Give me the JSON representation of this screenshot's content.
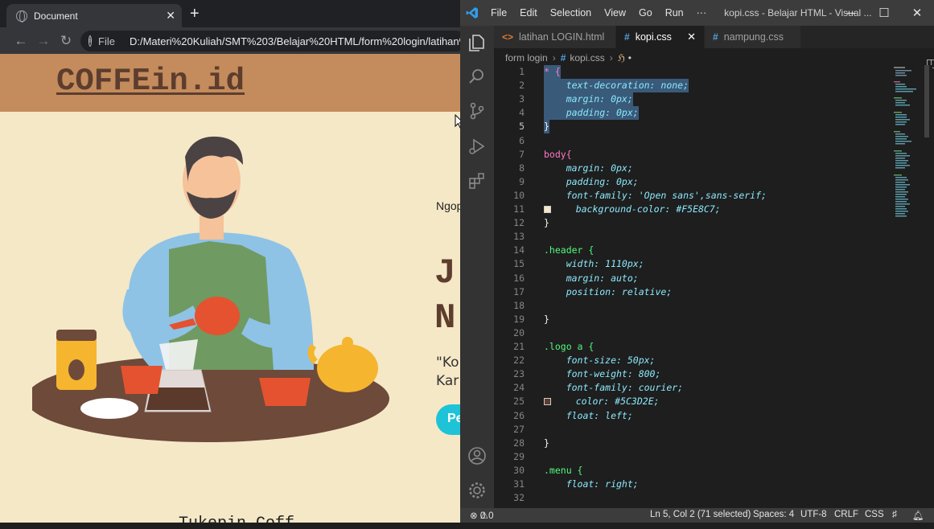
{
  "browser": {
    "tab_title": "Document",
    "file_label": "File",
    "url": "D:/Materi%20Kuliah/SMT%203/Belajar%20HTML/form%20login/latihan%",
    "site": {
      "logo": "COFFEin.id",
      "subtitle": "Ngop",
      "headline_line1": "J",
      "headline_line2": "N",
      "quote_line1": "\"Ko",
      "quote_line2": "Kar",
      "button_label": "Pe",
      "bottom_text": "Tukepin Coff"
    }
  },
  "vscode": {
    "menu": [
      "File",
      "Edit",
      "Selection",
      "View",
      "Go",
      "Run",
      "···"
    ],
    "window_title": "kopi.css - Belajar HTML - Visual ...",
    "tabs": [
      {
        "label": "latihan LOGIN.html",
        "icon": "<>",
        "active": false
      },
      {
        "label": "kopi.css",
        "icon": "#",
        "active": true
      },
      {
        "label": "nampung.css",
        "icon": "#",
        "active": false
      }
    ],
    "breadcrumb": {
      "folder": "form login",
      "file": "kopi.css",
      "modified_marker": "•"
    },
    "line_numbers": [
      "1",
      "2",
      "3",
      "4",
      "5",
      "6",
      "7",
      "8",
      "9",
      "10",
      "11",
      "12",
      "13",
      "14",
      "15",
      "16",
      "17",
      "18",
      "19",
      "20",
      "21",
      "22",
      "23",
      "24",
      "25",
      "26",
      "27",
      "28",
      "29",
      "30",
      "31",
      "32"
    ],
    "code_lines": [
      "* {",
      "    text-decoration: none;",
      "    margin: 0px;",
      "    padding: 0px;",
      "}",
      "",
      "body{",
      "    margin: 0px;",
      "    padding: 0px;",
      "    font-family: 'Open sans',sans-serif;",
      "    background-color: #F5E8C7;",
      "}",
      "",
      ".header {",
      "    width: 1110px;",
      "    margin: auto;",
      "    position: relative;",
      "",
      "}",
      "",
      ".logo a {",
      "    font-size: 50px;",
      "    font-weight: 800;",
      "    font-family: courier;",
      "    color: #5C3D2E;",
      "    float: left;",
      "",
      "}",
      "",
      ".menu {",
      "    float: right;",
      ""
    ],
    "swatch_colors": {
      "background": "#F5E8C7",
      "logo": "#5C3D2E"
    },
    "status": {
      "errors": "0",
      "warnings": "0",
      "position": "Ln 5, Col 2 (71 selected)",
      "spaces": "Spaces: 4",
      "encoding": "UTF-8",
      "eol": "CRLF",
      "language": "CSS"
    }
  }
}
